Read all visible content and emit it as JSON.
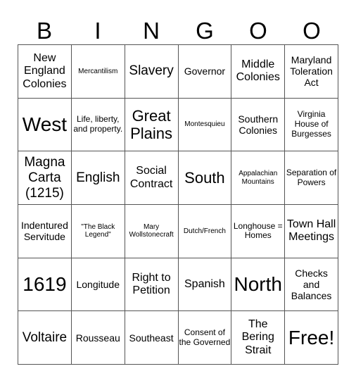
{
  "header": [
    "B",
    "I",
    "N",
    "G",
    "O",
    "O"
  ],
  "cells": [
    {
      "text": "New England Colonies",
      "size": "s-lg"
    },
    {
      "text": "Mercantilism",
      "size": "s-xs"
    },
    {
      "text": "Slavery",
      "size": "s-xl"
    },
    {
      "text": "Governor",
      "size": "s-md"
    },
    {
      "text": "Middle Colonies",
      "size": "s-lg"
    },
    {
      "text": "Maryland Toleration Act",
      "size": "s-md"
    },
    {
      "text": "West",
      "size": "s-huge"
    },
    {
      "text": "Life, liberty, and property.",
      "size": "s-sm"
    },
    {
      "text": "Great Plains",
      "size": "s-xxl"
    },
    {
      "text": "Montesquieu",
      "size": "s-xs"
    },
    {
      "text": "Southern Colonies",
      "size": "s-md"
    },
    {
      "text": "Virginia House of Burgesses",
      "size": "s-sm"
    },
    {
      "text": "Magna Carta (1215)",
      "size": "s-xl"
    },
    {
      "text": "English",
      "size": "s-xl"
    },
    {
      "text": "Social Contract",
      "size": "s-lg"
    },
    {
      "text": "South",
      "size": "s-xxl"
    },
    {
      "text": "Appalachian Mountains",
      "size": "s-xs"
    },
    {
      "text": "Separation of Powers",
      "size": "s-sm"
    },
    {
      "text": "Indentured Servitude",
      "size": "s-md"
    },
    {
      "text": "\"The Black Legend\"",
      "size": "s-xs"
    },
    {
      "text": "Mary Wollstonecraft",
      "size": "s-xs"
    },
    {
      "text": "Dutch/French",
      "size": "s-xs"
    },
    {
      "text": "Longhouse = Homes",
      "size": "s-sm"
    },
    {
      "text": "Town Hall Meetings",
      "size": "s-lg"
    },
    {
      "text": "1619",
      "size": "s-huge"
    },
    {
      "text": "Longitude",
      "size": "s-md"
    },
    {
      "text": "Right to Petition",
      "size": "s-lg"
    },
    {
      "text": "Spanish",
      "size": "s-lg"
    },
    {
      "text": "North",
      "size": "s-huge"
    },
    {
      "text": "Checks and Balances",
      "size": "s-md"
    },
    {
      "text": "Voltaire",
      "size": "s-xl"
    },
    {
      "text": "Rousseau",
      "size": "s-md"
    },
    {
      "text": "Southeast",
      "size": "s-md"
    },
    {
      "text": "Consent of the Governed",
      "size": "s-sm"
    },
    {
      "text": "The Bering Strait",
      "size": "s-lg"
    },
    {
      "text": "Free!",
      "size": "s-huge"
    }
  ]
}
